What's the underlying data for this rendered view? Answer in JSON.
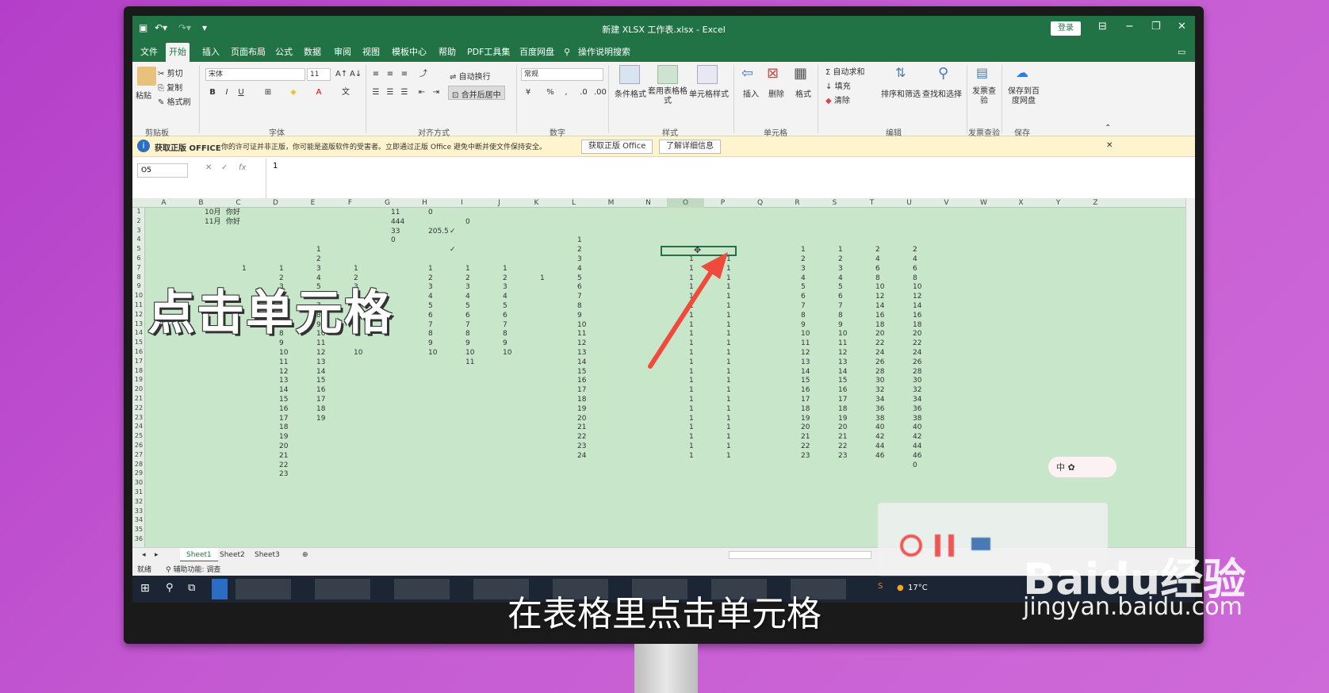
{
  "window": {
    "title": "新建 XLSX 工作表.xlsx - Excel",
    "login": "登录"
  },
  "ribbon_tabs": [
    "文件",
    "开始",
    "插入",
    "页面布局",
    "公式",
    "数据",
    "审阅",
    "视图",
    "模板中心",
    "帮助",
    "PDF工具集",
    "百度网盘"
  ],
  "tell_me": "操作说明搜索",
  "clipboard": {
    "paste": "粘贴",
    "cut": "剪切",
    "copy": "复制",
    "painter": "格式刷",
    "group": "剪贴板"
  },
  "font": {
    "name": "宋体",
    "size": "11",
    "group": "字体"
  },
  "alignment": {
    "wrap": "自动换行",
    "merge": "合并后居中",
    "group": "对齐方式"
  },
  "number": {
    "format": "常规",
    "group": "数字"
  },
  "styles": {
    "cond": "条件格式",
    "table": "套用表格格式",
    "cell": "单元格样式",
    "group": "样式"
  },
  "cells": {
    "insert": "插入",
    "delete": "删除",
    "format": "格式",
    "group": "单元格"
  },
  "editing": {
    "autosum": "自动求和",
    "fill": "填充",
    "clear": "清除",
    "sort": "排序和筛选",
    "find": "查找和选择",
    "group": "编辑"
  },
  "invoice": {
    "check": "发票查验",
    "group": "发票查验"
  },
  "save": {
    "baidu": "保存到百度网盘",
    "group": "保存"
  },
  "message": {
    "title": "获取正版 OFFICE",
    "text": "你的许可证并非正版，你可能是盗版软件的受害者。立即通过正版 Office 避免中断并使文件保持安全。",
    "btn1": "获取正版 Office",
    "btn2": "了解详细信息"
  },
  "formula": {
    "namebox": "O5",
    "value": "1"
  },
  "columns": [
    "A",
    "B",
    "C",
    "D",
    "E",
    "F",
    "G",
    "H",
    "I",
    "J",
    "K",
    "L",
    "M",
    "N",
    "O",
    "P",
    "Q",
    "R",
    "S",
    "T",
    "U",
    "V",
    "W",
    "X",
    "Y",
    "Z"
  ],
  "selected_column": "O",
  "cells_data": [
    [
      "B1",
      "10月"
    ],
    [
      "C1",
      "你好"
    ],
    [
      "G1",
      "11"
    ],
    [
      "H1",
      "0"
    ],
    [
      "B2",
      "11月"
    ],
    [
      "C2",
      "你好"
    ],
    [
      "G2",
      "444"
    ],
    [
      "I2",
      "0"
    ],
    [
      "G3",
      "33"
    ],
    [
      "H3",
      "205.5"
    ],
    [
      "I3",
      "✓"
    ],
    [
      "G4",
      "0"
    ],
    [
      "L4",
      "1"
    ],
    [
      "I5",
      "✓"
    ],
    [
      "E5",
      "1"
    ],
    [
      "L5",
      "2"
    ],
    [
      "R5",
      "1"
    ],
    [
      "S5",
      "1"
    ],
    [
      "T5",
      "2"
    ],
    [
      "U5",
      "2"
    ],
    [
      "E6",
      "2"
    ],
    [
      "L6",
      "3"
    ],
    [
      "O6",
      "1"
    ],
    [
      "P6",
      "1"
    ],
    [
      "R6",
      "2"
    ],
    [
      "S6",
      "2"
    ],
    [
      "T6",
      "4"
    ],
    [
      "U6",
      "4"
    ],
    [
      "C7",
      "1"
    ],
    [
      "D7",
      "1"
    ],
    [
      "E7",
      "3"
    ],
    [
      "F7",
      "1"
    ],
    [
      "H7",
      "1"
    ],
    [
      "I7",
      "1"
    ],
    [
      "J7",
      "1"
    ],
    [
      "L7",
      "4"
    ],
    [
      "O7",
      "1"
    ],
    [
      "P7",
      "1"
    ],
    [
      "R7",
      "3"
    ],
    [
      "S7",
      "3"
    ],
    [
      "T7",
      "6"
    ],
    [
      "U7",
      "6"
    ],
    [
      "D8",
      "2"
    ],
    [
      "E8",
      "4"
    ],
    [
      "F8",
      "2"
    ],
    [
      "H8",
      "2"
    ],
    [
      "I8",
      "2"
    ],
    [
      "J8",
      "2"
    ],
    [
      "K8",
      "1"
    ],
    [
      "L8",
      "5"
    ],
    [
      "O8",
      "1"
    ],
    [
      "P8",
      "1"
    ],
    [
      "R8",
      "4"
    ],
    [
      "S8",
      "4"
    ],
    [
      "T8",
      "8"
    ],
    [
      "U8",
      "8"
    ],
    [
      "D9",
      "3"
    ],
    [
      "E9",
      "5"
    ],
    [
      "F9",
      "3"
    ],
    [
      "H9",
      "3"
    ],
    [
      "I9",
      "3"
    ],
    [
      "J9",
      "3"
    ],
    [
      "L9",
      "6"
    ],
    [
      "O9",
      "1"
    ],
    [
      "P9",
      "1"
    ],
    [
      "R9",
      "5"
    ],
    [
      "S9",
      "5"
    ],
    [
      "T9",
      "10"
    ],
    [
      "U9",
      "10"
    ],
    [
      "D10",
      "4"
    ],
    [
      "E10",
      "6"
    ],
    [
      "H10",
      "4"
    ],
    [
      "I10",
      "4"
    ],
    [
      "J10",
      "4"
    ],
    [
      "L10",
      "7"
    ],
    [
      "O10",
      "1"
    ],
    [
      "P10",
      "1"
    ],
    [
      "R10",
      "6"
    ],
    [
      "S10",
      "6"
    ],
    [
      "T10",
      "12"
    ],
    [
      "U10",
      "12"
    ],
    [
      "D11",
      "5"
    ],
    [
      "E11",
      "7"
    ],
    [
      "H11",
      "5"
    ],
    [
      "I11",
      "5"
    ],
    [
      "J11",
      "5"
    ],
    [
      "L11",
      "8"
    ],
    [
      "O11",
      "1"
    ],
    [
      "P11",
      "1"
    ],
    [
      "R11",
      "7"
    ],
    [
      "S11",
      "7"
    ],
    [
      "T11",
      "14"
    ],
    [
      "U11",
      "14"
    ],
    [
      "D12",
      "6"
    ],
    [
      "E12",
      "8"
    ],
    [
      "H12",
      "6"
    ],
    [
      "I12",
      "6"
    ],
    [
      "J12",
      "6"
    ],
    [
      "L12",
      "9"
    ],
    [
      "O12",
      "1"
    ],
    [
      "P12",
      "1"
    ],
    [
      "R12",
      "8"
    ],
    [
      "S12",
      "8"
    ],
    [
      "T12",
      "16"
    ],
    [
      "U12",
      "16"
    ],
    [
      "D13",
      "7"
    ],
    [
      "E13",
      "9"
    ],
    [
      "H13",
      "7"
    ],
    [
      "I13",
      "7"
    ],
    [
      "J13",
      "7"
    ],
    [
      "L13",
      "10"
    ],
    [
      "O13",
      "1"
    ],
    [
      "P13",
      "1"
    ],
    [
      "R13",
      "9"
    ],
    [
      "S13",
      "9"
    ],
    [
      "T13",
      "18"
    ],
    [
      "U13",
      "18"
    ],
    [
      "D14",
      "8"
    ],
    [
      "E14",
      "10"
    ],
    [
      "H14",
      "8"
    ],
    [
      "I14",
      "8"
    ],
    [
      "J14",
      "8"
    ],
    [
      "L14",
      "11"
    ],
    [
      "O14",
      "1"
    ],
    [
      "P14",
      "1"
    ],
    [
      "R14",
      "10"
    ],
    [
      "S14",
      "10"
    ],
    [
      "T14",
      "20"
    ],
    [
      "U14",
      "20"
    ],
    [
      "D15",
      "9"
    ],
    [
      "E15",
      "11"
    ],
    [
      "H15",
      "9"
    ],
    [
      "I15",
      "9"
    ],
    [
      "J15",
      "9"
    ],
    [
      "L15",
      "12"
    ],
    [
      "O15",
      "1"
    ],
    [
      "P15",
      "1"
    ],
    [
      "R15",
      "11"
    ],
    [
      "S15",
      "11"
    ],
    [
      "T15",
      "22"
    ],
    [
      "U15",
      "22"
    ],
    [
      "D16",
      "10"
    ],
    [
      "E16",
      "12"
    ],
    [
      "F16",
      "10"
    ],
    [
      "H16",
      "10"
    ],
    [
      "I16",
      "10"
    ],
    [
      "J16",
      "10"
    ],
    [
      "L16",
      "13"
    ],
    [
      "O16",
      "1"
    ],
    [
      "P16",
      "1"
    ],
    [
      "R16",
      "12"
    ],
    [
      "S16",
      "12"
    ],
    [
      "T16",
      "24"
    ],
    [
      "U16",
      "24"
    ],
    [
      "D17",
      "11"
    ],
    [
      "E17",
      "13"
    ],
    [
      "I17",
      "11"
    ],
    [
      "L17",
      "14"
    ],
    [
      "O17",
      "1"
    ],
    [
      "P17",
      "1"
    ],
    [
      "R17",
      "13"
    ],
    [
      "S17",
      "13"
    ],
    [
      "T17",
      "26"
    ],
    [
      "U17",
      "26"
    ],
    [
      "D18",
      "12"
    ],
    [
      "E18",
      "14"
    ],
    [
      "L18",
      "15"
    ],
    [
      "O18",
      "1"
    ],
    [
      "P18",
      "1"
    ],
    [
      "R18",
      "14"
    ],
    [
      "S18",
      "14"
    ],
    [
      "T18",
      "28"
    ],
    [
      "U18",
      "28"
    ],
    [
      "D19",
      "13"
    ],
    [
      "E19",
      "15"
    ],
    [
      "L19",
      "16"
    ],
    [
      "O19",
      "1"
    ],
    [
      "P19",
      "1"
    ],
    [
      "R19",
      "15"
    ],
    [
      "S19",
      "15"
    ],
    [
      "T19",
      "30"
    ],
    [
      "U19",
      "30"
    ],
    [
      "D20",
      "14"
    ],
    [
      "E20",
      "16"
    ],
    [
      "L20",
      "17"
    ],
    [
      "O20",
      "1"
    ],
    [
      "P20",
      "1"
    ],
    [
      "R20",
      "16"
    ],
    [
      "S20",
      "16"
    ],
    [
      "T20",
      "32"
    ],
    [
      "U20",
      "32"
    ],
    [
      "D21",
      "15"
    ],
    [
      "E21",
      "17"
    ],
    [
      "L21",
      "18"
    ],
    [
      "O21",
      "1"
    ],
    [
      "P21",
      "1"
    ],
    [
      "R21",
      "17"
    ],
    [
      "S21",
      "17"
    ],
    [
      "T21",
      "34"
    ],
    [
      "U21",
      "34"
    ],
    [
      "D22",
      "16"
    ],
    [
      "E22",
      "18"
    ],
    [
      "L22",
      "19"
    ],
    [
      "O22",
      "1"
    ],
    [
      "P22",
      "1"
    ],
    [
      "R22",
      "18"
    ],
    [
      "S22",
      "18"
    ],
    [
      "T22",
      "36"
    ],
    [
      "U22",
      "36"
    ],
    [
      "D23",
      "17"
    ],
    [
      "E23",
      "19"
    ],
    [
      "L23",
      "20"
    ],
    [
      "O23",
      "1"
    ],
    [
      "P23",
      "1"
    ],
    [
      "R23",
      "19"
    ],
    [
      "S23",
      "19"
    ],
    [
      "T23",
      "38"
    ],
    [
      "U23",
      "38"
    ],
    [
      "D24",
      "18"
    ],
    [
      "L24",
      "21"
    ],
    [
      "O24",
      "1"
    ],
    [
      "P24",
      "1"
    ],
    [
      "R24",
      "20"
    ],
    [
      "S24",
      "20"
    ],
    [
      "T24",
      "40"
    ],
    [
      "U24",
      "40"
    ],
    [
      "D25",
      "19"
    ],
    [
      "L25",
      "22"
    ],
    [
      "O25",
      "1"
    ],
    [
      "P25",
      "1"
    ],
    [
      "R25",
      "21"
    ],
    [
      "S25",
      "21"
    ],
    [
      "T25",
      "42"
    ],
    [
      "U25",
      "42"
    ],
    [
      "D26",
      "20"
    ],
    [
      "L26",
      "23"
    ],
    [
      "O26",
      "1"
    ],
    [
      "P26",
      "1"
    ],
    [
      "R26",
      "22"
    ],
    [
      "S26",
      "22"
    ],
    [
      "T26",
      "44"
    ],
    [
      "U26",
      "44"
    ],
    [
      "D27",
      "21"
    ],
    [
      "L27",
      "24"
    ],
    [
      "O27",
      "1"
    ],
    [
      "P27",
      "1"
    ],
    [
      "R27",
      "23"
    ],
    [
      "S27",
      "23"
    ],
    [
      "T27",
      "46"
    ],
    [
      "U27",
      "46"
    ],
    [
      "D28",
      "22"
    ],
    [
      "U28",
      "0"
    ],
    [
      "D29",
      "23"
    ]
  ],
  "sheets": [
    "Sheet1",
    "Sheet2",
    "Sheet3"
  ],
  "status": {
    "ready": "就绪",
    "access": "辅助功能: 调查"
  },
  "taskbar": {
    "temp": "17°C"
  },
  "ime": "中",
  "overlay": "点击单元格",
  "subtitle": "在表格里点击单元格",
  "watermark": {
    "logo": "Baidu经验",
    "url": "jingyan.baidu.com"
  },
  "colors": {
    "excel_green": "#217346",
    "grid_green": "#c7e6ca",
    "arrow": "#f04a3d"
  }
}
